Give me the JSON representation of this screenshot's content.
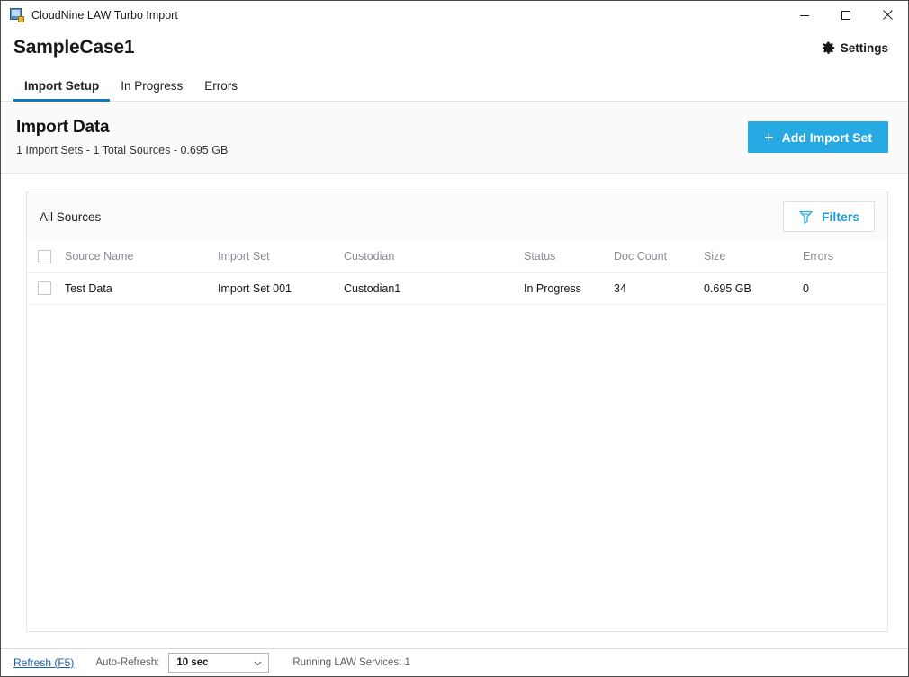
{
  "window": {
    "title": "CloudNine LAW Turbo Import",
    "app_icon": "app-window-icon",
    "controls": {
      "minimize": "minimize-icon",
      "maximize": "maximize-icon",
      "close": "close-icon"
    }
  },
  "case_header": {
    "case_name": "SampleCase1",
    "settings_label": "Settings",
    "settings_icon": "gear-icon"
  },
  "tabs": [
    {
      "label": "Import Setup",
      "active": true
    },
    {
      "label": "In Progress",
      "active": false
    },
    {
      "label": "Errors",
      "active": false
    }
  ],
  "import_band": {
    "title": "Import Data",
    "summary": "1 Import Sets - 1 Total Sources - 0.695 GB",
    "add_button_label": "Add Import Set",
    "add_button_icon": "plus-icon"
  },
  "panel": {
    "title": "All Sources",
    "filters_label": "Filters",
    "filters_icon": "funnel-icon"
  },
  "table": {
    "columns": [
      "Source Name",
      "Import Set",
      "Custodian",
      "Status",
      "Doc Count",
      "Size",
      "Errors"
    ],
    "rows": [
      {
        "source_name": "Test Data",
        "import_set": "Import Set 001",
        "custodian": "Custodian1",
        "status": "In Progress",
        "doc_count": "34",
        "size": "0.695 GB",
        "errors": "0"
      }
    ]
  },
  "status_bar": {
    "refresh_label": "Refresh (F5)",
    "auto_refresh_label": "Auto-Refresh:",
    "auto_refresh_value": "10 sec",
    "services_text": "Running LAW Services: 1"
  },
  "colors": {
    "accent_blue": "#27a9e3",
    "tab_underline": "#0b7cc1",
    "filters_blue": "#1f9bd8",
    "link_blue": "#1a5fa8"
  }
}
